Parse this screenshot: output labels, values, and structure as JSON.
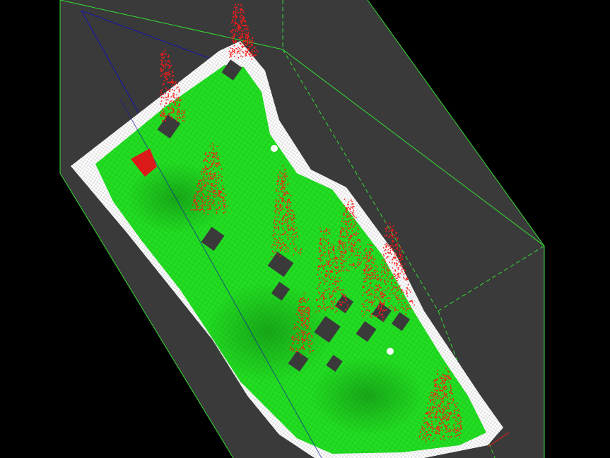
{
  "view": {
    "type": "3d-point-cloud-viewer",
    "description_free": true
  },
  "colors": {
    "background": "#000000",
    "bounding_box_fill": "#3a3a3a",
    "bounding_box_edge": "#33dd33",
    "ground_mesh": "#22dd22",
    "ground_mesh_line": "#0f8a0f",
    "border_points": "#ffffff",
    "vegetation_points": "#ff1a1a",
    "shadow_blocks": "#3a3a3a",
    "axis_line": "#1a1aa0",
    "axis_line_red": "#cc2222"
  },
  "layers": [
    {
      "name": "bounding-box",
      "visible": true
    },
    {
      "name": "ground-mesh",
      "visible": true
    },
    {
      "name": "border-points",
      "visible": true
    },
    {
      "name": "vegetation-points",
      "visible": true
    }
  ]
}
